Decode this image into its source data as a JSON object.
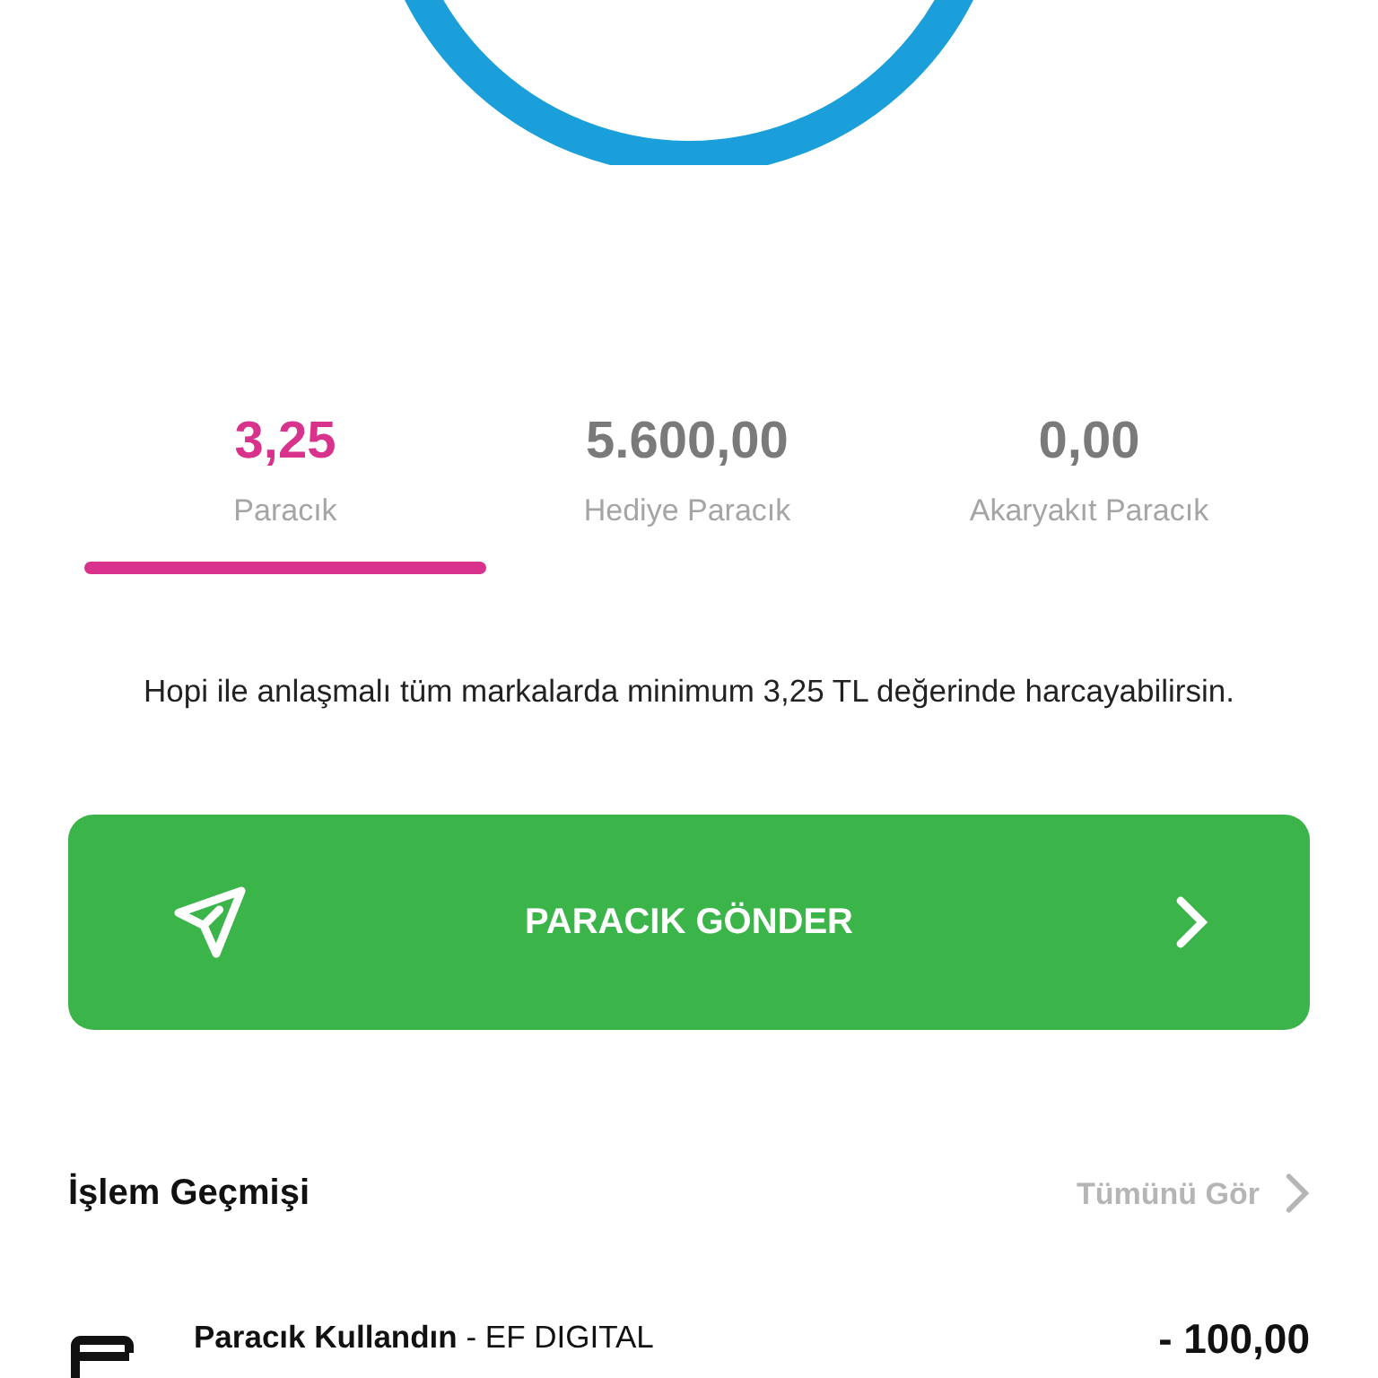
{
  "tabs": [
    {
      "value": "3,25",
      "label": "Paracık",
      "selected": true
    },
    {
      "value": "5.600,00",
      "label": "Hediye Paracık",
      "selected": false
    },
    {
      "value": "0,00",
      "label": "Akaryakıt Paracık",
      "selected": false
    }
  ],
  "info": "Hopi ile anlaşmalı tüm markalarda minimum 3,25 TL değerinde harcayabilirsin.",
  "send_button": "PARACIK GÖNDER",
  "history": {
    "title": "İşlem Geçmişi",
    "see_all": "Tümünü Gör",
    "items": [
      {
        "title": "Paracık Kullandın",
        "merchant": " - EF DIGITAL",
        "amount": "- 100,00"
      }
    ]
  }
}
